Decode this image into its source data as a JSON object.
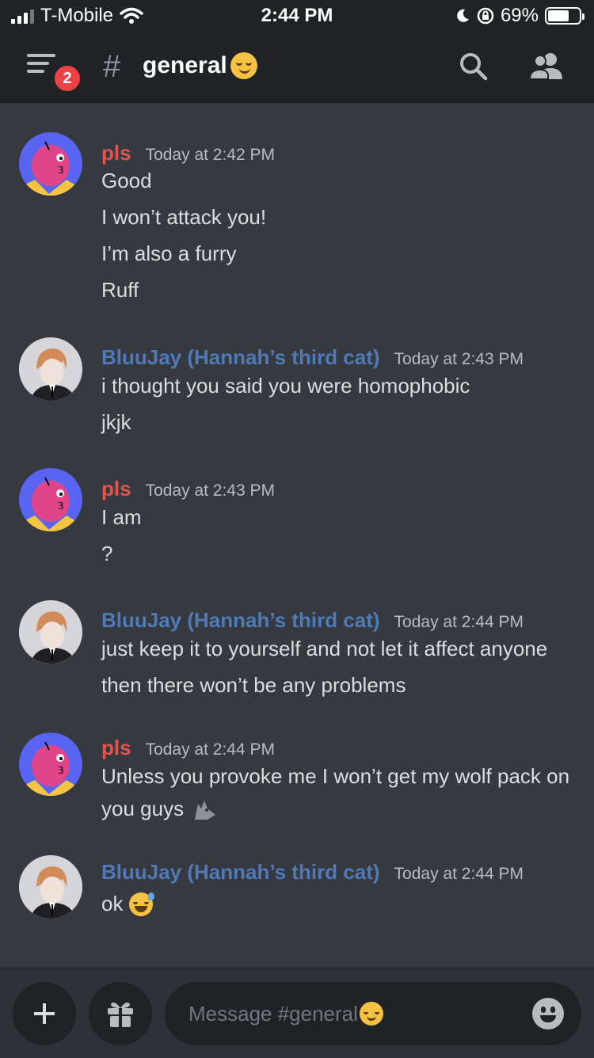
{
  "status_bar": {
    "carrier": "T-Mobile",
    "time": "2:44 PM",
    "battery": "69%"
  },
  "header": {
    "badge_count": "2",
    "hash_symbol": "#",
    "channel_name": "general"
  },
  "messages": [
    {
      "author": "pls",
      "timestamp": "Today at 2:42 PM",
      "lines": [
        "Good",
        "I won’t attack you!",
        "I’m also a furry",
        "Ruff"
      ]
    },
    {
      "author": "BluuJay (Hannah’s third cat)",
      "timestamp": "Today at 2:43 PM",
      "lines": [
        "i thought you said you were homophobic",
        "jkjk"
      ]
    },
    {
      "author": "pls",
      "timestamp": "Today at 2:43 PM",
      "lines": [
        "I am",
        "?"
      ]
    },
    {
      "author": "BluuJay (Hannah’s third cat)",
      "timestamp": "Today at 2:44 PM",
      "lines": [
        "just keep it to yourself and not let it affect anyone",
        "then there won’t be any problems"
      ]
    },
    {
      "author": "pls",
      "timestamp": "Today at 2:44 PM",
      "lines": [
        "Unless you provoke me I won’t get my wolf pack on",
        "you guys"
      ]
    },
    {
      "author": "BluuJay (Hannah’s third cat)",
      "timestamp": "Today at 2:44 PM",
      "lines": [
        "ok"
      ]
    }
  ],
  "composer": {
    "placeholder": "Message #general"
  },
  "colors": {
    "background": "#36393f",
    "header": "#202225",
    "pls_name": "#e0564c",
    "bluujay_name": "#4f7ab8",
    "badge": "#ed4245"
  }
}
